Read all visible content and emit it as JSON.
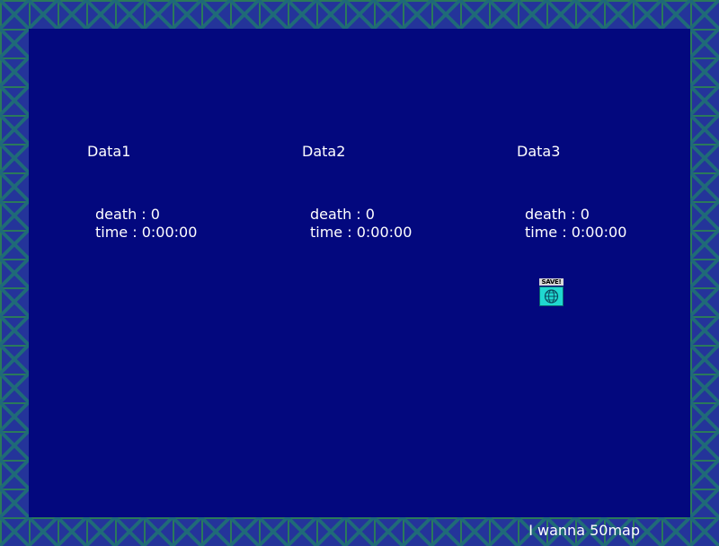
{
  "save_slots": [
    {
      "title": "Data1",
      "death_label": "death : 0",
      "time_label": "time : 0:00:00"
    },
    {
      "title": "Data2",
      "death_label": "death : 0",
      "time_label": "time : 0:00:00"
    },
    {
      "title": "Data3",
      "death_label": "death : 0",
      "time_label": "time : 0:00:00"
    }
  ],
  "save_icon": {
    "label": "SAVE!",
    "icon": "save-point-globe-icon"
  },
  "footer": {
    "game_title": "I wanna 50map"
  },
  "colors": {
    "background": "#03087e",
    "border_tile": "#24349a",
    "text": "#ffffff",
    "save_icon": "#20d8d0"
  }
}
